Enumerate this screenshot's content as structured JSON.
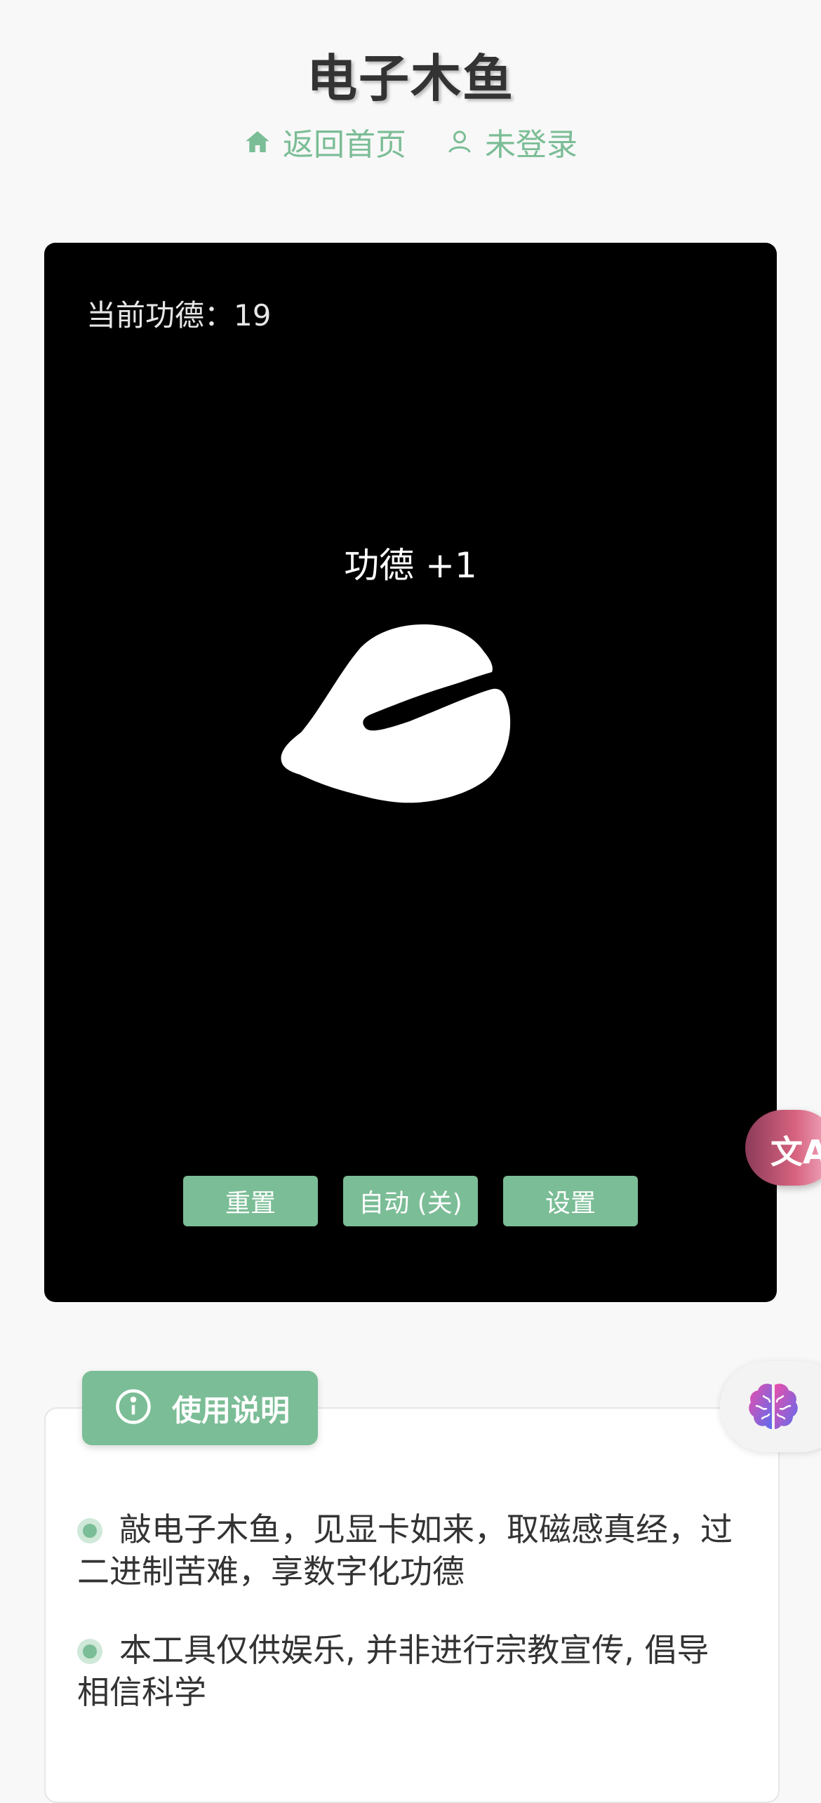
{
  "header": {
    "title": "电子木鱼",
    "nav": {
      "home_label": "返回首页",
      "user_label": "未登录"
    }
  },
  "stage": {
    "merit_label": "当前功德：19",
    "plus_text": "功德 +1",
    "buttons": {
      "reset": "重置",
      "auto": "自动 (关)",
      "settings": "设置"
    }
  },
  "translate_fab": {
    "glyph": "文A"
  },
  "usage": {
    "title": "使用说明",
    "items": [
      "敲电子木鱼，见显卡如来，取磁感真经，过二进制苦难，享数字化功德",
      "本工具仅供娱乐, 并非进行宗教宣传, 倡导相信科学"
    ]
  },
  "colors": {
    "accent": "#7bbd96",
    "stage_bg": "#000000",
    "page_bg": "#f8f8f8"
  },
  "icons": [
    "home-icon",
    "user-icon",
    "woodfish-icon",
    "translate-icon",
    "brain-icon",
    "info-icon"
  ]
}
